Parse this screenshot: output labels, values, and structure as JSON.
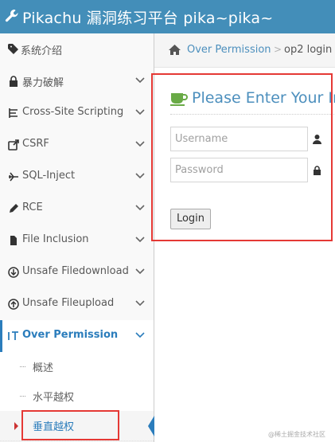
{
  "header": {
    "brand": "Pikachu 漏洞练习平台 pika~pika~"
  },
  "sidebar": {
    "items": [
      {
        "label": "系统介绍",
        "icon": "tags-icon",
        "has_chevron": false
      },
      {
        "label": "暴力破解",
        "icon": "lock-icon",
        "has_chevron": true
      },
      {
        "label": "Cross-Site Scripting",
        "icon": "list-icon",
        "has_chevron": true
      },
      {
        "label": "CSRF",
        "icon": "share-icon",
        "has_chevron": true
      },
      {
        "label": "SQL-Inject",
        "icon": "plane-icon",
        "has_chevron": true
      },
      {
        "label": "RCE",
        "icon": "pencil-icon",
        "has_chevron": true
      },
      {
        "label": "File Inclusion",
        "icon": "file-icon",
        "has_chevron": true
      },
      {
        "label": "Unsafe Filedownload",
        "icon": "download-icon",
        "has_chevron": true
      },
      {
        "label": "Unsafe Fileupload",
        "icon": "upload-icon",
        "has_chevron": true
      },
      {
        "label": "Over Permission",
        "icon": "text-height-icon",
        "has_chevron": true,
        "active": true
      }
    ],
    "sub_items": [
      {
        "label": "概述"
      },
      {
        "label": "水平越权"
      },
      {
        "label": "垂直越权",
        "current": true
      }
    ]
  },
  "breadcrumb": {
    "link": "Over Permission",
    "separator": ">",
    "current": "op2 login"
  },
  "login": {
    "title": "Please Enter Your Information",
    "username_placeholder": "Username",
    "password_placeholder": "Password",
    "button": "Login"
  },
  "watermark": "@稀土掘金技术社区",
  "colors": {
    "topbar": "#438eb9",
    "accent": "#2b7dbc",
    "highlight_box": "#e53935",
    "title_green": "#6fb3e0"
  }
}
